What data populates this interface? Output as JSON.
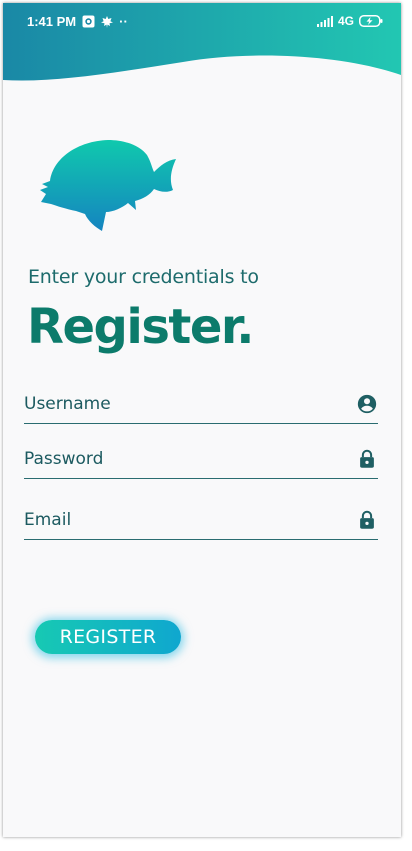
{
  "status_bar": {
    "time": "1:41 PM",
    "dots": "··",
    "network": "4G"
  },
  "auth": {
    "subtitle": "Enter your credentials to",
    "title": "Register."
  },
  "form": {
    "username": {
      "placeholder": "Username",
      "value": "",
      "icon": "account-circle-icon"
    },
    "password": {
      "placeholder": "Password",
      "value": "",
      "icon": "lock-icon"
    },
    "email": {
      "placeholder": "Email",
      "value": "",
      "icon": "lock-icon"
    }
  },
  "actions": {
    "register_label": "REGISTER"
  },
  "colors": {
    "header_gradient": [
      "#1a88a6",
      "#22c7b2"
    ],
    "title": "#0c7b6b",
    "text": "#1d6b6c",
    "field_line": "#2a6c70",
    "button_gradient": [
      "#17c9b3",
      "#0fa7cf"
    ]
  }
}
